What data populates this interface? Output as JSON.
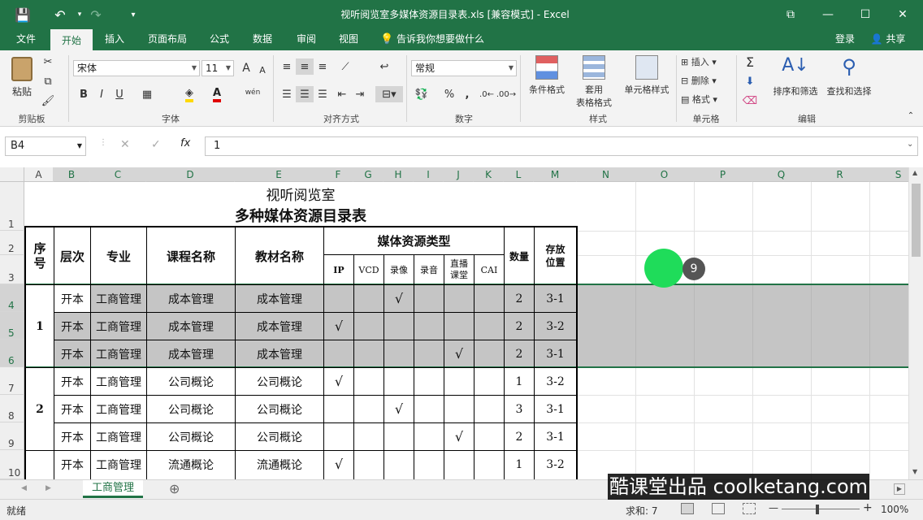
{
  "titlebar": {
    "title": "视听阅览室多媒体资源目录表.xls  [兼容模式] - Excel",
    "save_icon": "💾",
    "undo_icon": "↶",
    "redo_icon": "↷",
    "qat_more_icon": "▾",
    "restore_ribbon_icon": "⧉",
    "minimize_icon": "—",
    "maximize_icon": "☐",
    "close_icon": "✕"
  },
  "tabs": [
    "文件",
    "开始",
    "插入",
    "页面布局",
    "公式",
    "数据",
    "审阅",
    "视图"
  ],
  "active_tab": "开始",
  "tell_me": "告诉我你想要做什么",
  "login": "登录",
  "share": "共享",
  "ribbon": {
    "clipboard": {
      "label": "剪贴板",
      "paste": "粘贴"
    },
    "font": {
      "label": "字体",
      "name": "宋体",
      "size": "11",
      "bold": "B",
      "italic": "I",
      "underline": "U",
      "grow": "A",
      "shrink": "A",
      "font_color_glyph": "A",
      "phonetic": "wén"
    },
    "alignment": {
      "label": "对齐方式"
    },
    "number": {
      "label": "数字",
      "format": "常规",
      "percent": "%",
      "comma": ","
    },
    "styles": {
      "label": "样式",
      "cond_format": "条件格式",
      "table_format_1": "套用",
      "table_format_2": "表格格式",
      "cell_style": "单元格样式"
    },
    "cells": {
      "label": "单元格",
      "insert": "插入",
      "delete": "删除",
      "format": "格式"
    },
    "editing": {
      "label": "编辑",
      "sort_filter": "排序和筛选",
      "find_select": "查找和选择",
      "sum_glyph": "Σ"
    }
  },
  "formula_bar": {
    "name_box": "B4",
    "cancel": "✕",
    "enter": "✓",
    "fx": "fx",
    "value": "1"
  },
  "columns": [
    "A",
    "B",
    "C",
    "D",
    "E",
    "F",
    "G",
    "H",
    "I",
    "J",
    "K",
    "L",
    "M",
    "N",
    "O",
    "P",
    "Q",
    "R",
    "S"
  ],
  "rows": [
    "1",
    "2",
    "3",
    "4",
    "5",
    "6",
    "7",
    "8",
    "9",
    "10"
  ],
  "sheet": {
    "line1": "视听阅览室",
    "line2": "多种媒体资源目录表",
    "header": {
      "seq": "序号",
      "level": "层次",
      "major": "专业",
      "course": "课程名称",
      "textbook": "教材名称",
      "media_type": "媒体资源类型",
      "ip": "IP",
      "vcd": "VCD",
      "video": "录像",
      "audio": "录音",
      "live": "直播课堂",
      "cai": "CAI",
      "qty": "数量",
      "location": "存放位置"
    },
    "groups": [
      "1",
      "2"
    ],
    "data_rows": [
      {
        "level": "开本",
        "major": "工商管理",
        "course": "成本管理",
        "textbook": "成本管理",
        "check_col": "video",
        "qty": "2",
        "location": "3-1"
      },
      {
        "level": "开本",
        "major": "工商管理",
        "course": "成本管理",
        "textbook": "成本管理",
        "check_col": "ip",
        "qty": "2",
        "location": "3-2"
      },
      {
        "level": "开本",
        "major": "工商管理",
        "course": "成本管理",
        "textbook": "成本管理",
        "check_col": "live",
        "qty": "2",
        "location": "3-1"
      },
      {
        "level": "开本",
        "major": "工商管理",
        "course": "公司概论",
        "textbook": "公司概论",
        "check_col": "ip",
        "qty": "1",
        "location": "3-2"
      },
      {
        "level": "开本",
        "major": "工商管理",
        "course": "公司概论",
        "textbook": "公司概论",
        "check_col": "video",
        "qty": "3",
        "location": "3-1"
      },
      {
        "level": "开本",
        "major": "工商管理",
        "course": "公司概论",
        "textbook": "公司概论",
        "check_col": "live",
        "qty": "2",
        "location": "3-1"
      },
      {
        "level": "开本",
        "major": "工商管理",
        "course": "流通概论",
        "textbook": "流通概论",
        "check_col": "ip",
        "qty": "1",
        "location": "3-2"
      }
    ],
    "check_mark": "√"
  },
  "sheet_tab": "工商管理",
  "add_sheet_icon": "⊕",
  "status": {
    "ready": "就绪",
    "sum": "求和: 7",
    "zoom": "100%",
    "zoom_minus": "—",
    "zoom_plus": "+"
  },
  "overlay": {
    "step": "9",
    "watermark": "酷课堂出品 coolketang.com"
  }
}
